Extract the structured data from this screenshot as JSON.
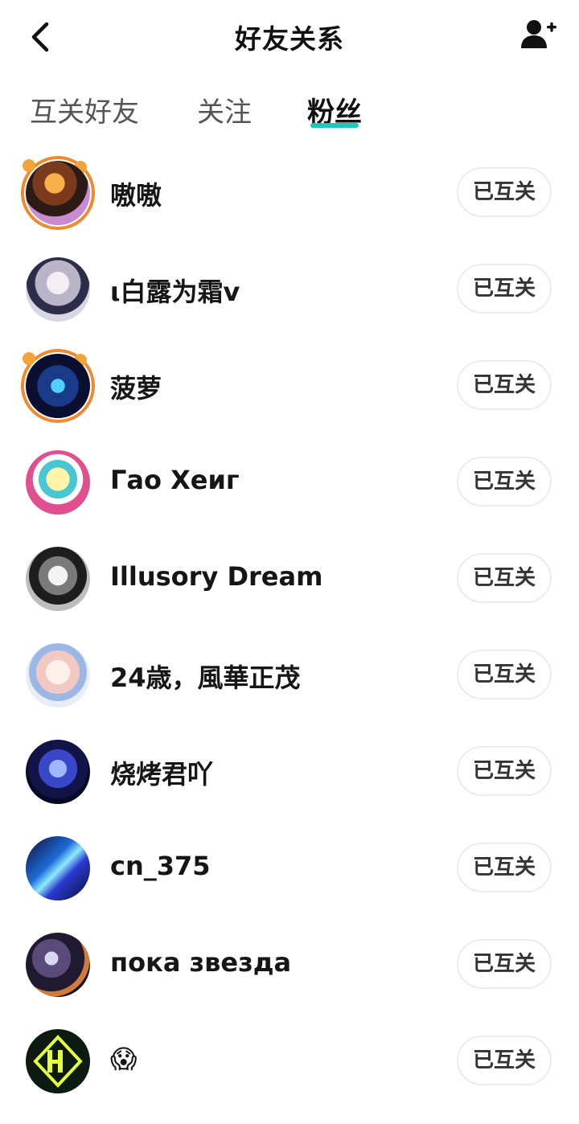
{
  "header": {
    "title": "好友关系",
    "back_icon": "chevron-left-icon",
    "add_icon": "add-user-icon"
  },
  "tabs": [
    {
      "label": "互关好友",
      "active": false
    },
    {
      "label": "关注",
      "active": false
    },
    {
      "label": "粉丝",
      "active": true
    }
  ],
  "accent_color": "#1ec8b8",
  "users": [
    {
      "name": "嗷嗷",
      "button": "已互关"
    },
    {
      "name": "ι白露为霜v",
      "button": "已互关"
    },
    {
      "name": "菠萝",
      "button": "已互关"
    },
    {
      "name": "Гао Хеиг",
      "button": "已互关"
    },
    {
      "name": "Illusory Dream",
      "button": "已互关"
    },
    {
      "name": "24歳，風華正茂",
      "button": "已互关"
    },
    {
      "name": "烧烤君吖",
      "button": "已互关"
    },
    {
      "name": "cn_375",
      "button": "已互关"
    },
    {
      "name": "пока звезда",
      "button": "已互关"
    },
    {
      "name": "😱",
      "button": "已互关"
    }
  ]
}
